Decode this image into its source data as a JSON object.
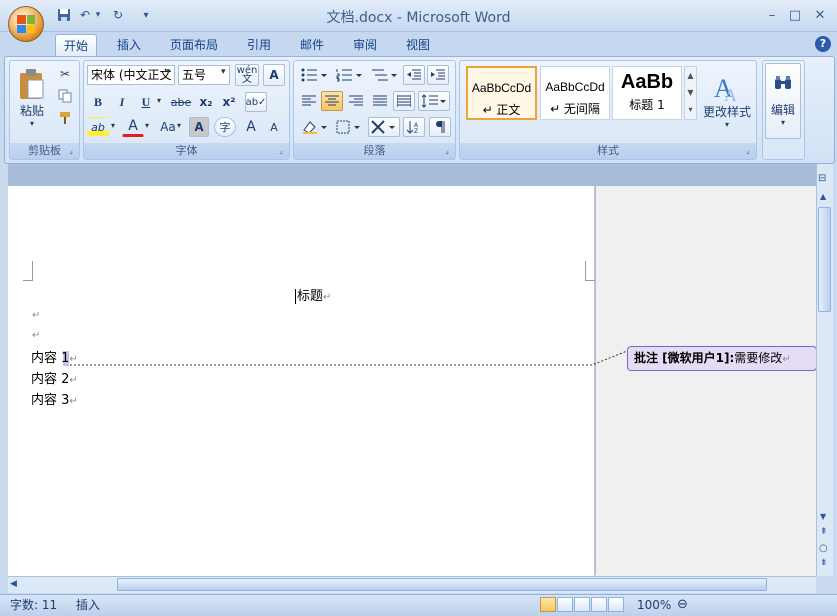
{
  "window": {
    "title": "文档.docx - Microsoft Word",
    "controls": {
      "minimize": "–",
      "maximize": "□",
      "close": "✕"
    }
  },
  "quick_access": {
    "save_icon": "save-icon",
    "undo": "↶",
    "redo": "↻",
    "customize": "▾"
  },
  "tabs": [
    {
      "label": "开始",
      "active": true
    },
    {
      "label": "插入"
    },
    {
      "label": "页面布局"
    },
    {
      "label": "引用"
    },
    {
      "label": "邮件"
    },
    {
      "label": "审阅"
    },
    {
      "label": "视图"
    }
  ],
  "help": "?",
  "clipboard": {
    "paste_label": "粘贴",
    "group_label": "剪贴板"
  },
  "font": {
    "name": "宋体 (中文正文",
    "size": "五号",
    "group_label": "字体",
    "wen": "wén\n文",
    "bold": "B",
    "italic": "I",
    "underline": "U",
    "strike": "abe",
    "subscript": "x₂",
    "superscript": "x²",
    "highlight": "ab",
    "color": "A",
    "case": "Aa",
    "shade": "A",
    "enclose": "字",
    "grow": "A",
    "shrink": "A"
  },
  "paragraph": {
    "group_label": "段落"
  },
  "styles": {
    "group_label": "样式",
    "items": [
      {
        "sample": "AaBbCcDd",
        "name": "↵ 正文"
      },
      {
        "sample": "AaBbCcDd",
        "name": "↵ 无间隔"
      },
      {
        "sample": "AaBb",
        "name": "标题 1"
      }
    ],
    "change_label": "更改样式"
  },
  "editing": {
    "label": "编辑"
  },
  "document": {
    "heading": "标题",
    "empty_marks": [
      "↵",
      "↵"
    ],
    "lines": [
      "内容 1",
      "内容 2",
      "内容 3"
    ],
    "para_mark": "↵"
  },
  "comment": {
    "prefix": "批注 [微软用户1]:",
    "text": "需要修改",
    "mark": "↵"
  },
  "status": {
    "word_count": "字数: 11",
    "mode": "插入",
    "zoom": "100%"
  },
  "colors": {
    "ribbon_bg": "#d1e1f5",
    "accent": "#15428b",
    "comment_bg": "#e4dcf5",
    "comment_border": "#7b68c0"
  }
}
